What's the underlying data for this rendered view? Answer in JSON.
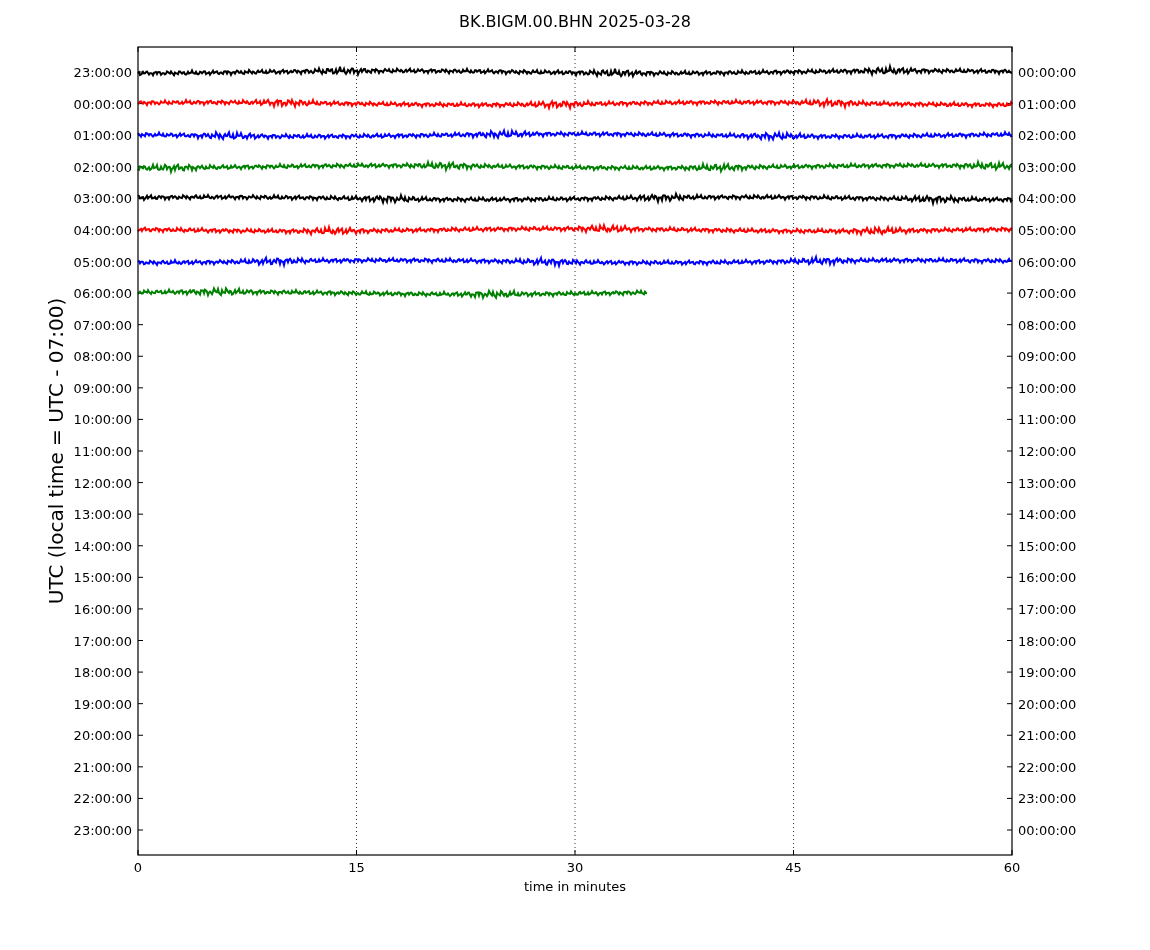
{
  "title": "BK.BIGM.00.BHN 2025-03-28",
  "ylabel": "UTC (local time = UTC - 07:00)",
  "xlabel": "time in minutes",
  "xticks": [
    "0",
    "15",
    "30",
    "45",
    "60"
  ],
  "left_labels": [
    "23:00:00",
    "00:00:00",
    "01:00:00",
    "02:00:00",
    "03:00:00",
    "04:00:00",
    "05:00:00",
    "06:00:00",
    "07:00:00",
    "08:00:00",
    "09:00:00",
    "10:00:00",
    "11:00:00",
    "12:00:00",
    "13:00:00",
    "14:00:00",
    "15:00:00",
    "16:00:00",
    "17:00:00",
    "18:00:00",
    "19:00:00",
    "20:00:00",
    "21:00:00",
    "22:00:00",
    "23:00:00"
  ],
  "right_labels": [
    "00:00:00",
    "01:00:00",
    "02:00:00",
    "03:00:00",
    "04:00:00",
    "05:00:00",
    "06:00:00",
    "07:00:00",
    "08:00:00",
    "09:00:00",
    "10:00:00",
    "11:00:00",
    "12:00:00",
    "13:00:00",
    "14:00:00",
    "15:00:00",
    "16:00:00",
    "17:00:00",
    "18:00:00",
    "19:00:00",
    "20:00:00",
    "21:00:00",
    "22:00:00",
    "23:00:00",
    "00:00:00"
  ],
  "traces": [
    {
      "color": "#000000",
      "level": 1
    },
    {
      "color": "#ff0000",
      "level": 1
    },
    {
      "color": "#0000ff",
      "level": 1
    },
    {
      "color": "#008000",
      "level": 1
    },
    {
      "color": "#000000",
      "level": 1
    },
    {
      "color": "#ff0000",
      "level": 1
    },
    {
      "color": "#0000ff",
      "level": 1
    },
    {
      "color": "#008000",
      "level": 0.583
    }
  ]
}
